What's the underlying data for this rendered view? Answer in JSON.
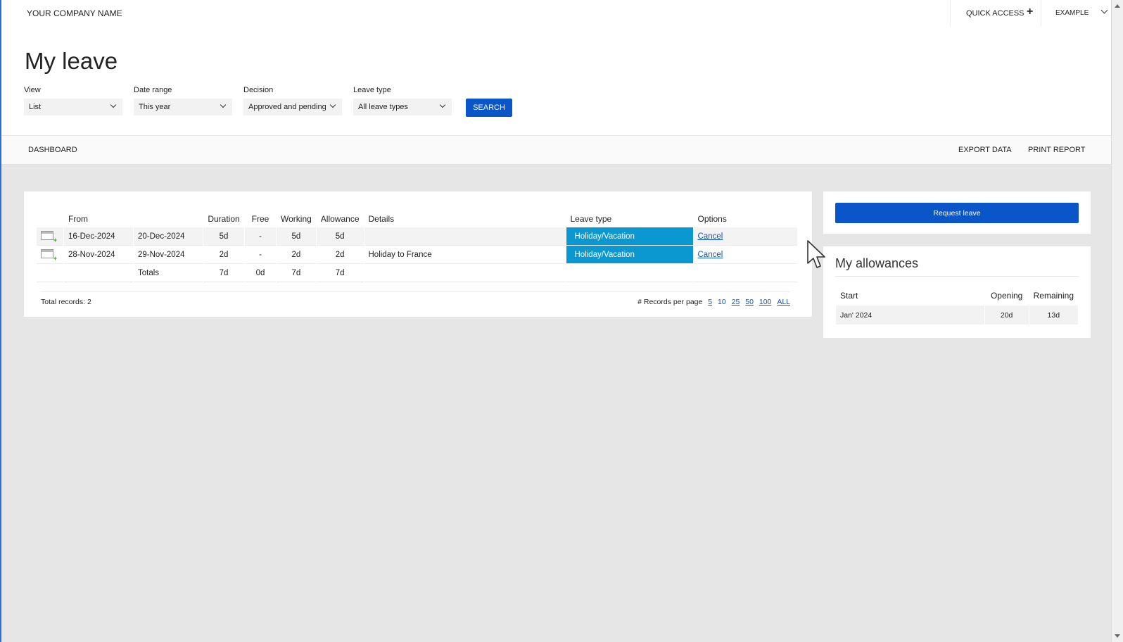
{
  "topbar": {
    "company": "YOUR COMPANY NAME",
    "quick_access": "QUICK ACCESS",
    "quick_access_icon": "plus-icon",
    "user_menu": "EXAMPLE",
    "user_menu_icon": "chevron-down-icon"
  },
  "page": {
    "title": "My leave"
  },
  "filters": {
    "view": {
      "label": "View",
      "value": "List"
    },
    "date_range": {
      "label": "Date range",
      "value": "This year"
    },
    "decision": {
      "label": "Decision",
      "value": "Approved and pending"
    },
    "leave_type": {
      "label": "Leave type",
      "value": "All leave types"
    },
    "search_label": "SEARCH"
  },
  "subnav": {
    "dashboard": "DASHBOARD",
    "export": "EXPORT DATA",
    "print": "PRINT REPORT"
  },
  "leave_table": {
    "headers": {
      "from": "From",
      "duration": "Duration",
      "free": "Free",
      "working": "Working",
      "allowance": "Allowance",
      "details": "Details",
      "leave_type": "Leave type",
      "options": "Options"
    },
    "rows": [
      {
        "from": "16-Dec-2024",
        "to": "20-Dec-2024",
        "duration": "5d",
        "free": "-",
        "working": "5d",
        "allowance": "5d",
        "details": "",
        "leave_type": "Holiday/Vacation",
        "option": "Cancel"
      },
      {
        "from": "28-Nov-2024",
        "to": "29-Nov-2024",
        "duration": "2d",
        "free": "-",
        "working": "2d",
        "allowance": "2d",
        "details": "Holiday to France",
        "leave_type": "Holiday/Vacation",
        "option": "Cancel"
      }
    ],
    "totals": {
      "label": "Totals",
      "duration": "7d",
      "free": "0d",
      "working": "7d",
      "allowance": "7d"
    },
    "leave_type_color": "#0b98d0",
    "total_records": "Total records: 2",
    "records_per_page_label": "# Records per page",
    "records_per_page_options": [
      "5",
      "10",
      "25",
      "50",
      "100",
      "ALL"
    ],
    "records_per_page_selected": "10"
  },
  "request": {
    "label": "Request leave"
  },
  "allowances": {
    "title": "My allowances",
    "headers": {
      "start": "Start",
      "opening": "Opening",
      "remaining": "Remaining"
    },
    "rows": [
      {
        "start": "Jan' 2024",
        "opening": "20d",
        "remaining": "13d"
      }
    ]
  },
  "colors": {
    "accent": "#0a55c8",
    "leave_type": "#0b98d0",
    "background": "#e6e6e6"
  }
}
